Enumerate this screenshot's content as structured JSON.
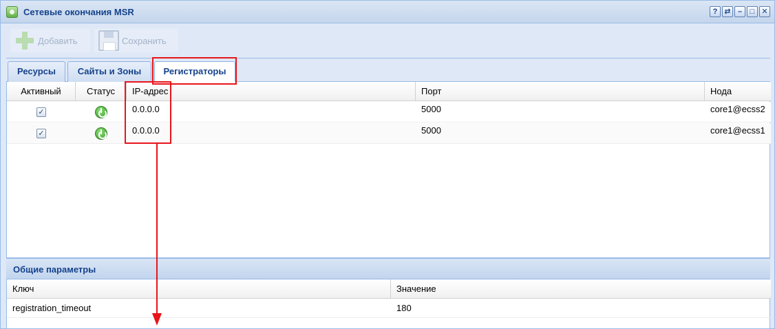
{
  "window": {
    "title": "Сетевые окончания MSR",
    "tools": [
      "?",
      "⇄",
      "–",
      "□",
      "✕"
    ]
  },
  "toolbar": {
    "add_label": "Добавить",
    "save_label": "Сохранить"
  },
  "tabs": [
    {
      "label": "Ресурсы",
      "active": false
    },
    {
      "label": "Сайты и Зоны",
      "active": false
    },
    {
      "label": "Регистраторы",
      "active": true
    }
  ],
  "registrars": {
    "columns": [
      "Активный",
      "Статус",
      "IP-адрес",
      "Порт",
      "Нода"
    ],
    "rows": [
      {
        "active": true,
        "status": "power-icon",
        "ip": "0.0.0.0",
        "port": "5000",
        "node": "core1@ecss2"
      },
      {
        "active": true,
        "status": "power-icon",
        "ip": "0.0.0.0",
        "port": "5000",
        "node": "core1@ecss1"
      }
    ]
  },
  "params": {
    "title": "Общие параметры",
    "columns": [
      "Ключ",
      "Значение"
    ],
    "rows": [
      {
        "key": "registration_timeout",
        "value": "180"
      }
    ]
  },
  "colors": {
    "accent": "#15428b",
    "highlight": "#e8141a",
    "status_ok": "#3d9b2b"
  }
}
